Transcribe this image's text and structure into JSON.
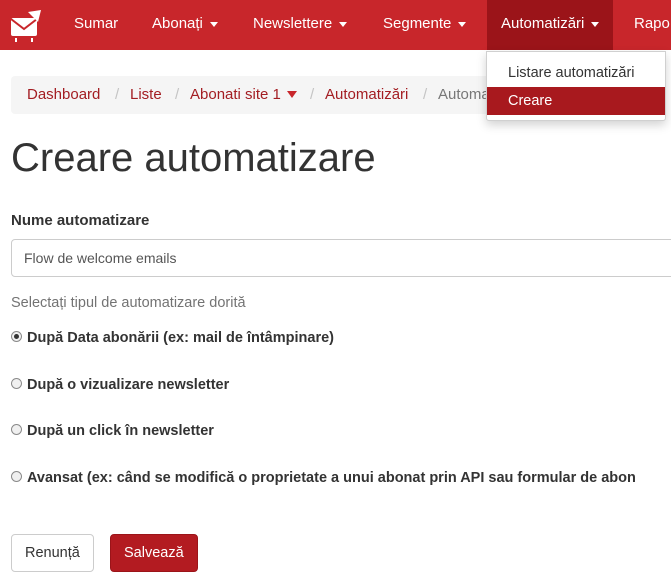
{
  "navbar": {
    "items": [
      {
        "label": "Sumar",
        "has_caret": false
      },
      {
        "label": "Abonați",
        "has_caret": true
      },
      {
        "label": "Newslettere",
        "has_caret": true
      },
      {
        "label": "Segmente",
        "has_caret": true
      },
      {
        "label": "Automatizări",
        "has_caret": true,
        "active": true
      },
      {
        "label": "Rapo",
        "has_caret": false
      }
    ],
    "logo_icon": "envelope-logo-icon",
    "brand_color": "#c8262b",
    "active_color": "#9b1419"
  },
  "dropdown": {
    "items": [
      {
        "label": "Listare automatizări",
        "active": false
      },
      {
        "label": "Creare",
        "active": true
      }
    ]
  },
  "breadcrumb": {
    "items": [
      "Dashboard",
      "Liste",
      "Abonati site 1",
      "Automatizări",
      "Automa"
    ]
  },
  "page": {
    "title": "Creare automatizare"
  },
  "form": {
    "name_label": "Nume automatizare",
    "name_value": "Flow de welcome emails",
    "type_help": "Selectați tipul de automatizare dorită",
    "options": [
      {
        "label": "După Data abonării (ex: mail de întâmpinare)",
        "checked": true
      },
      {
        "label": "După o vizualizare newsletter",
        "checked": false
      },
      {
        "label": "După un click în newsletter",
        "checked": false
      },
      {
        "label": "Avansat (ex: când se modifică o proprietate a unui abonat prin API sau formular de abon",
        "checked": false
      }
    ],
    "cancel_label": "Renunță",
    "save_label": "Salvează"
  }
}
